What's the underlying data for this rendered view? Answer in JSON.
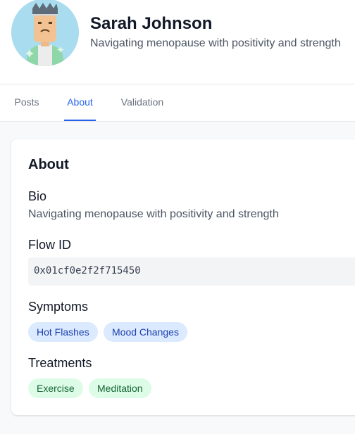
{
  "profile": {
    "name": "Sarah Johnson",
    "tagline": "Navigating menopause with positivity and strength"
  },
  "tabs": [
    {
      "label": "Posts",
      "active": false
    },
    {
      "label": "About",
      "active": true
    },
    {
      "label": "Validation",
      "active": false
    }
  ],
  "about": {
    "title": "About",
    "bio_label": "Bio",
    "bio": "Navigating menopause with positivity and strength",
    "flow_label": "Flow ID",
    "flow_id": "0x01cf0e2f2f715450",
    "symptoms_label": "Symptoms",
    "symptoms": [
      "Hot Flashes",
      "Mood Changes"
    ],
    "treatments_label": "Treatments",
    "treatments": [
      "Exercise",
      "Meditation"
    ]
  },
  "colors": {
    "accent": "#2563eb",
    "symptom_chip_bg": "#dbeafe",
    "treatment_chip_bg": "#dcfce7"
  }
}
